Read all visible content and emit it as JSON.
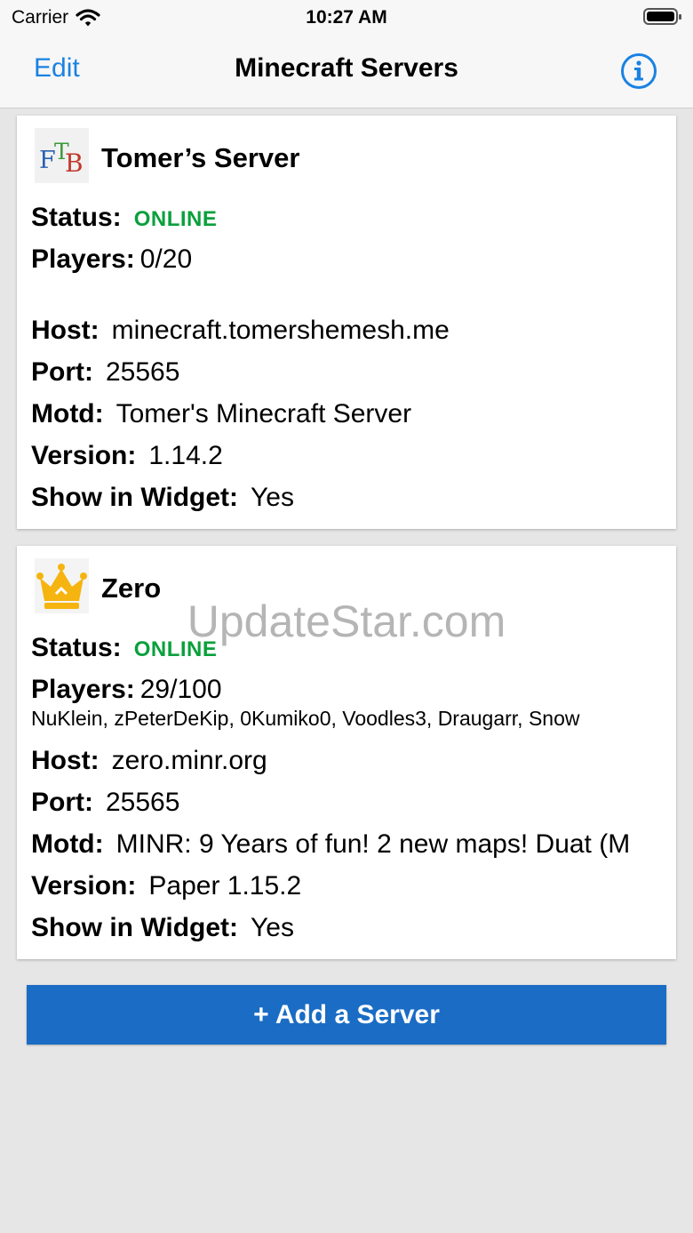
{
  "statusbar": {
    "carrier": "Carrier",
    "time": "10:27 AM"
  },
  "nav": {
    "edit": "Edit",
    "title": "Minecraft Servers",
    "info_icon": "info-circle-icon"
  },
  "accent_color": "#1a82e2",
  "online_color": "#0aa03c",
  "servers": [
    {
      "name": "Tomer’s Server",
      "logo": "ftb-logo",
      "status_label": "Status:",
      "status": "ONLINE",
      "players_label": "Players:",
      "players": "0/20",
      "player_list": "",
      "host_label": "Host:",
      "host": "minecraft.tomershemesh.me",
      "port_label": "Port:",
      "port": "25565",
      "motd_label": "Motd:",
      "motd": "Tomer's Minecraft Server",
      "version_label": "Version:",
      "version": "1.14.2",
      "widget_label": "Show in Widget:",
      "widget": "Yes"
    },
    {
      "name": "Zero",
      "logo": "crown-logo",
      "status_label": "Status:",
      "status": "ONLINE",
      "players_label": "Players:",
      "players": "29/100",
      "player_list": "NuKlein, zPeterDeKip, 0Kumiko0, Voodles3, Draugarr, Snow",
      "host_label": "Host:",
      "host": "zero.minr.org",
      "port_label": "Port:",
      "port": "25565",
      "motd_label": "Motd:",
      "motd": "MINR: 9 Years of fun! 2 new maps! Duat (M",
      "version_label": "Version:",
      "version": "Paper 1.15.2",
      "widget_label": "Show in Widget:",
      "widget": "Yes"
    }
  ],
  "add_button": "+ Add a Server",
  "watermark": "UpdateStar.com"
}
